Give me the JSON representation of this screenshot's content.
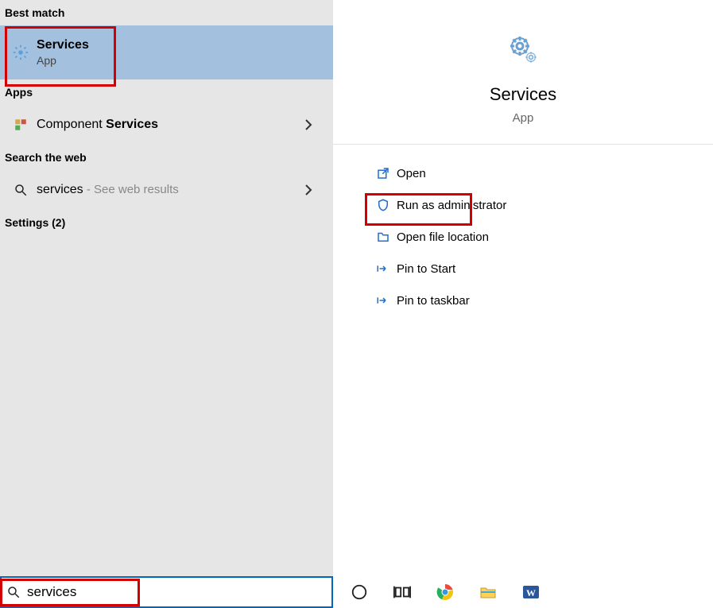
{
  "left": {
    "best_match_header": "Best match",
    "services": {
      "title": "Services",
      "sub": "App"
    },
    "apps_header": "Apps",
    "component": {
      "prefix": "Component ",
      "bold": "Services"
    },
    "web_header": "Search the web",
    "web": {
      "term": "services",
      "suffix": " - See web results"
    },
    "settings_header": "Settings (2)"
  },
  "right": {
    "title": "Services",
    "sub": "App",
    "actions": {
      "open": "Open",
      "admin": "Run as administrator",
      "location": "Open file location",
      "pin_start": "Pin to Start",
      "pin_taskbar": "Pin to taskbar"
    }
  },
  "search": {
    "value": "services"
  }
}
